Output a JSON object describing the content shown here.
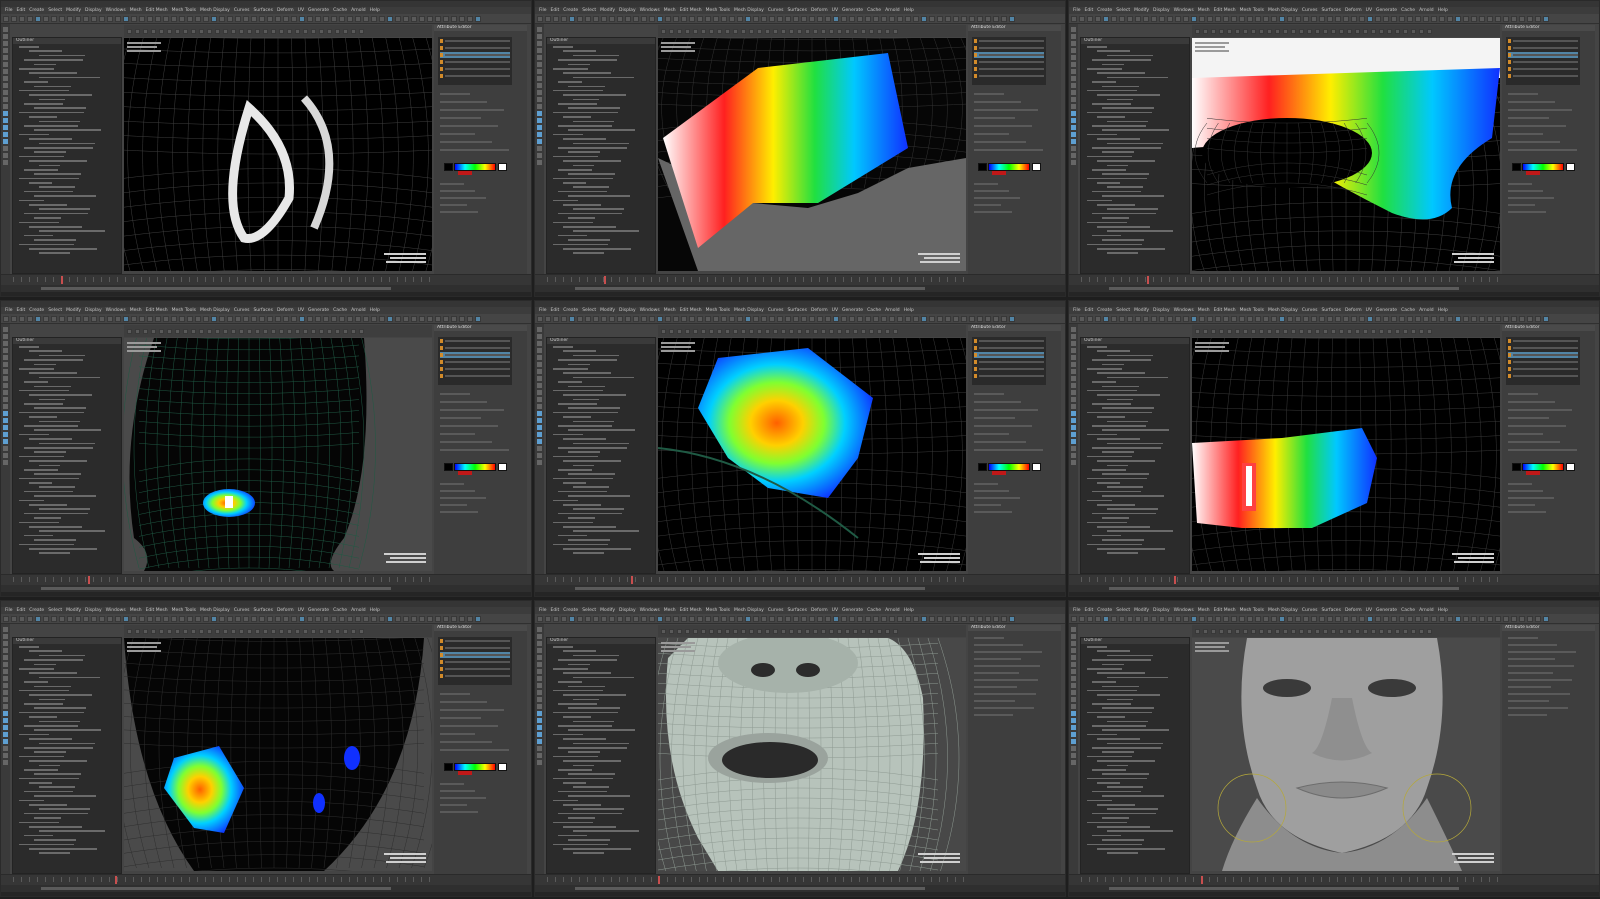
{
  "menu_items": [
    "File",
    "Edit",
    "Create",
    "Select",
    "Modify",
    "Display",
    "Windows",
    "Mesh",
    "Edit Mesh",
    "Mesh Tools",
    "Mesh Display",
    "Curves",
    "Surfaces",
    "Deform",
    "UV",
    "Generate",
    "Cache",
    "Arnold",
    "Help"
  ],
  "outliner": {
    "title": "Outliner"
  },
  "attribute_editor": {
    "title": "Attribute Editor"
  },
  "panels": [
    {
      "id": "p1",
      "viewport_content": "mouth-ring-white"
    },
    {
      "id": "p2",
      "viewport_content": "gradient-slab"
    },
    {
      "id": "p3",
      "viewport_content": "mouth-rainbow"
    },
    {
      "id": "p4",
      "viewport_content": "head-front-small-weight"
    },
    {
      "id": "p5",
      "viewport_content": "cheek-weight"
    },
    {
      "id": "p6",
      "viewport_content": "lip-band-weight"
    },
    {
      "id": "p7",
      "viewport_content": "chin-weight"
    },
    {
      "id": "p8",
      "viewport_content": "face-closeup-open-mouth"
    },
    {
      "id": "p9",
      "viewport_content": "face-front-gray"
    }
  ],
  "colors": {
    "ui_bg": "#444444",
    "viewport_bg": "#000000",
    "selection_blue": "#5285a6",
    "key_red": "#c94f4f",
    "swatch_orange": "#d28b2a"
  }
}
